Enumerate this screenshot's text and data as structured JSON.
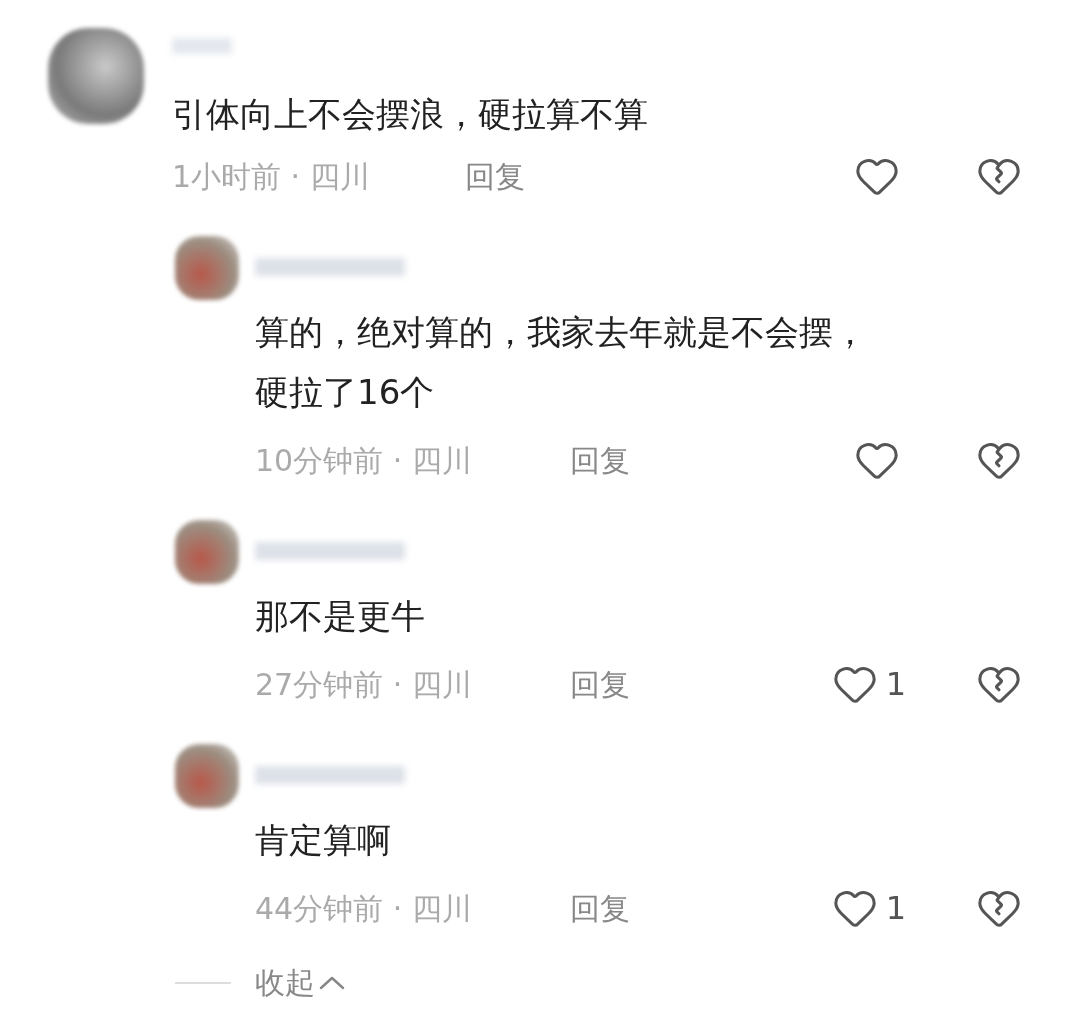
{
  "comments": [
    {
      "text": "引体向上不会摆浪，硬拉算不算",
      "meta": "1小时前 · 四川",
      "reply": "回复",
      "replies": [
        {
          "text": "算的，绝对算的，我家去年就是不会摆，硬拉了16个",
          "meta": "10分钟前 · 四川",
          "reply": "回复"
        },
        {
          "text": "那不是更牛",
          "meta": "27分钟前 · 四川",
          "reply": "回复",
          "likes": "1"
        },
        {
          "text": "肯定算啊",
          "meta": "44分钟前 · 四川",
          "reply": "回复",
          "likes": "1"
        }
      ]
    }
  ],
  "collapse": "收起"
}
